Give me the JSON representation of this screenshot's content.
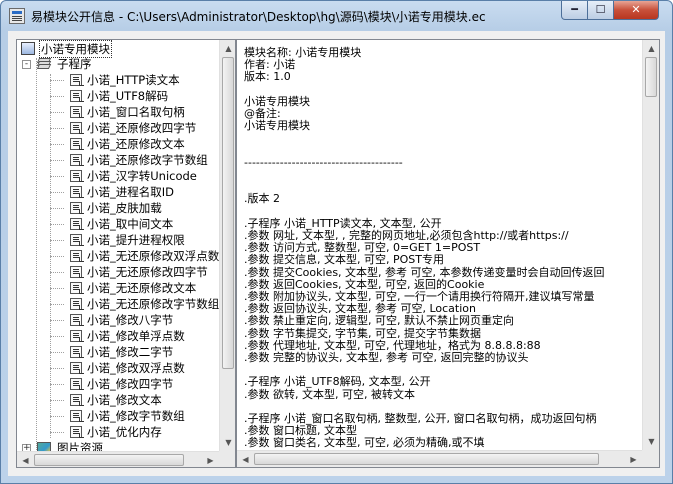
{
  "window": {
    "title": "易模块公开信息 - C:\\Users\\Administrator\\Desktop\\hg\\源码\\模块\\小诺专用模块.ec",
    "minimize_glyph": "━",
    "maximize_glyph": "☐",
    "close_glyph": "✕",
    "accent_color": "#bcd2ea",
    "close_color": "#c8503a"
  },
  "tree": {
    "root": {
      "label": "小诺专用模块",
      "icon": "module-icon",
      "expander": "-"
    },
    "group": {
      "label": "子程序",
      "icon": "layers-icon",
      "expander": "-"
    },
    "items": [
      "小诺_HTTP读文本",
      "小诺_UTF8解码",
      "小诺_窗口名取句柄",
      "小诺_还原修改四字节",
      "小诺_还原修改文本",
      "小诺_还原修改字节数组",
      "小诺_汉字转Unicode",
      "小诺_进程名取ID",
      "小诺_皮肤加载",
      "小诺_取中间文本",
      "小诺_提升进程权限",
      "小诺_无还原修改双浮点数",
      "小诺_无还原修改四字节",
      "小诺_无还原修改文本",
      "小诺_无还原修改字节数组",
      "小诺_修改八字节",
      "小诺_修改单浮点数",
      "小诺_修改二字节",
      "小诺_修改双浮点数",
      "小诺_修改四字节",
      "小诺_修改文本",
      "小诺_修改字节数组",
      "小诺_优化内存"
    ],
    "partial": {
      "label": "图片资源",
      "icon": "image-icon",
      "expander": "+"
    }
  },
  "code": {
    "lines": [
      "模块名称: 小诺专用模块",
      "作者: 小诺",
      "版本: 1.0",
      "",
      "小诺专用模块",
      "@备注:",
      "小诺专用模块",
      "",
      "",
      "----------------------------------------",
      "",
      "",
      ".版本 2",
      "",
      ".子程序 小诺_HTTP读文本, 文本型, 公开",
      ".参数 网址, 文本型, , 完整的网页地址,必须包含http://或者https://",
      ".参数 访问方式, 整数型, 可空, 0=GET 1=POST",
      ".参数 提交信息, 文本型, 可空, POST专用",
      ".参数 提交Cookies, 文本型, 参考 可空, 本参数传递变量时会自动回传返回",
      ".参数 返回Cookies, 文本型, 可空, 返回的Cookie",
      ".参数 附加协议头, 文本型, 可空, 一行一个请用换行符隔开,建议填写常量",
      ".参数 返回协议头, 文本型, 参考 可空, Location",
      ".参数 禁止重定向, 逻辑型, 可空, 默认不禁止网页重定向",
      ".参数 字节集提交, 字节集, 可空, 提交字节集数据",
      ".参数 代理地址, 文本型, 可空, 代理地址，格式为 8.8.8.8:88",
      ".参数 完整的协议头, 文本型, 参考 可空, 返回完整的协议头",
      "",
      ".子程序 小诺_UTF8解码, 文本型, 公开",
      ".参数 欲转, 文本型, 可空, 被转文本",
      "",
      ".子程序 小诺_窗口名取句柄, 整数型, 公开, 窗口名取句柄，成功返回句柄",
      ".参数 窗口标题, 文本型",
      ".参数 窗口类名, 文本型, 可空, 必须为精确,或不填"
    ]
  },
  "scroll": {
    "up": "▲",
    "down": "▼",
    "left": "◀",
    "right": "▶"
  }
}
